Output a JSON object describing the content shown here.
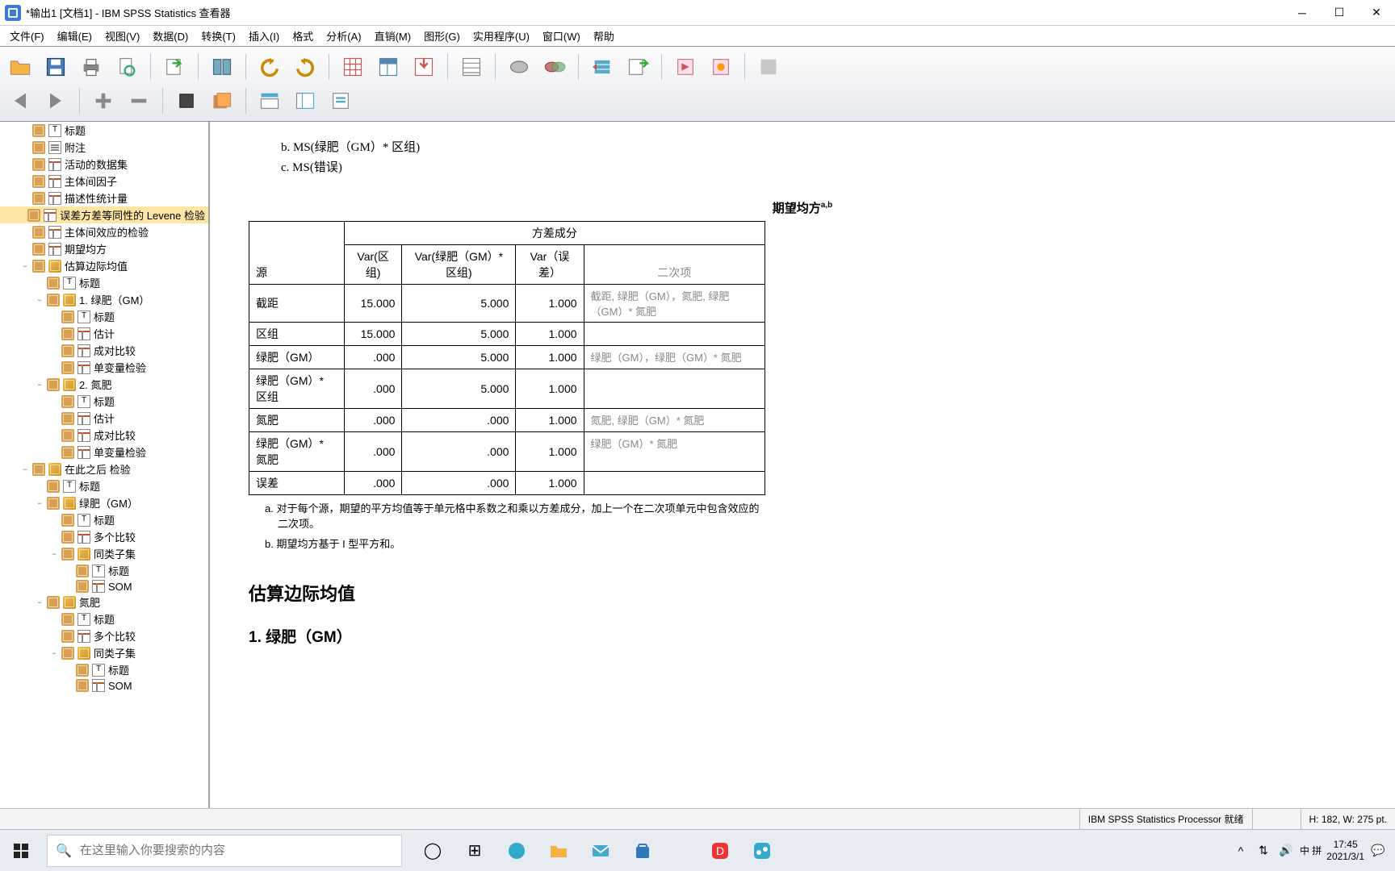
{
  "window": {
    "title": "*输出1 [文档1] - IBM SPSS Statistics 查看器"
  },
  "menu": {
    "file": "文件(F)",
    "edit": "编辑(E)",
    "view": "视图(V)",
    "data": "数据(D)",
    "transform": "转换(T)",
    "insert": "插入(I)",
    "format": "格式",
    "analyze": "分析(A)",
    "direct": "直销(M)",
    "graphs": "图形(G)",
    "utilities": "实用程序(U)",
    "window": "窗口(W)",
    "help": "帮助"
  },
  "outline": {
    "items": [
      {
        "label": "标题",
        "indent": 1,
        "icon": "title",
        "toggle": ""
      },
      {
        "label": "附注",
        "indent": 1,
        "icon": "note",
        "toggle": ""
      },
      {
        "label": "活动的数据集",
        "indent": 1,
        "icon": "table",
        "toggle": ""
      },
      {
        "label": "主体间因子",
        "indent": 1,
        "icon": "table",
        "toggle": ""
      },
      {
        "label": "描述性统计量",
        "indent": 1,
        "icon": "table",
        "toggle": ""
      },
      {
        "label": "误差方差等同性的 Levene 检验",
        "indent": 1,
        "icon": "table",
        "toggle": "",
        "selected": true
      },
      {
        "label": "主体间效应的检验",
        "indent": 1,
        "icon": "table",
        "toggle": ""
      },
      {
        "label": "期望均方",
        "indent": 1,
        "icon": "table",
        "toggle": ""
      },
      {
        "label": "估算边际均值",
        "indent": 1,
        "icon": "cube",
        "toggle": "−"
      },
      {
        "label": "标题",
        "indent": 2,
        "icon": "title",
        "toggle": ""
      },
      {
        "label": "1. 绿肥（GM）",
        "indent": 2,
        "icon": "cube",
        "toggle": "−"
      },
      {
        "label": "标题",
        "indent": 3,
        "icon": "title",
        "toggle": ""
      },
      {
        "label": "估计",
        "indent": 3,
        "icon": "table",
        "toggle": ""
      },
      {
        "label": "成对比较",
        "indent": 3,
        "icon": "table",
        "toggle": ""
      },
      {
        "label": "单变量检验",
        "indent": 3,
        "icon": "table",
        "toggle": ""
      },
      {
        "label": "2. 氮肥",
        "indent": 2,
        "icon": "cube",
        "toggle": "−"
      },
      {
        "label": "标题",
        "indent": 3,
        "icon": "title",
        "toggle": ""
      },
      {
        "label": "估计",
        "indent": 3,
        "icon": "table",
        "toggle": ""
      },
      {
        "label": "成对比较",
        "indent": 3,
        "icon": "table",
        "toggle": ""
      },
      {
        "label": "单变量检验",
        "indent": 3,
        "icon": "table",
        "toggle": ""
      },
      {
        "label": "在此之后 检验",
        "indent": 1,
        "icon": "cube",
        "toggle": "−"
      },
      {
        "label": "标题",
        "indent": 2,
        "icon": "title",
        "toggle": ""
      },
      {
        "label": "绿肥（GM）",
        "indent": 2,
        "icon": "cube",
        "toggle": "−"
      },
      {
        "label": "标题",
        "indent": 3,
        "icon": "title",
        "toggle": ""
      },
      {
        "label": "多个比较",
        "indent": 3,
        "icon": "table",
        "toggle": ""
      },
      {
        "label": "同类子集",
        "indent": 3,
        "icon": "cube",
        "toggle": "−"
      },
      {
        "label": "标题",
        "indent": 4,
        "icon": "title",
        "toggle": ""
      },
      {
        "label": "SOM",
        "indent": 4,
        "icon": "table",
        "toggle": ""
      },
      {
        "label": "氮肥",
        "indent": 2,
        "icon": "cube",
        "toggle": "−"
      },
      {
        "label": "标题",
        "indent": 3,
        "icon": "title",
        "toggle": ""
      },
      {
        "label": "多个比较",
        "indent": 3,
        "icon": "table",
        "toggle": ""
      },
      {
        "label": "同类子集",
        "indent": 3,
        "icon": "cube",
        "toggle": "−"
      },
      {
        "label": "标题",
        "indent": 4,
        "icon": "title",
        "toggle": ""
      },
      {
        "label": "SOM",
        "indent": 4,
        "icon": "table",
        "toggle": ""
      }
    ]
  },
  "content": {
    "line_b": "b. MS(绿肥（GM）* 区组)",
    "line_c": "c. MS(错误)",
    "table_title": "期望均方",
    "table_title_sup": "a,b",
    "col_source": "源",
    "col_group": "方差成分",
    "col_var1": "Var(区组)",
    "col_var2": "Var(绿肥（GM）* 区组)",
    "col_var3": "Var（误差）",
    "col_q": "二次项",
    "rows": [
      {
        "label": "截距",
        "v1": "15.000",
        "v2": "5.000",
        "v3": "1.000",
        "q": "截距, 绿肥（GM），氮肥, 绿肥（GM）* 氮肥"
      },
      {
        "label": "区组",
        "v1": "15.000",
        "v2": "5.000",
        "v3": "1.000",
        "q": ""
      },
      {
        "label": "绿肥（GM）",
        "v1": ".000",
        "v2": "5.000",
        "v3": "1.000",
        "q": "绿肥（GM），绿肥（GM）* 氮肥"
      },
      {
        "label": "绿肥（GM）* 区组",
        "v1": ".000",
        "v2": "5.000",
        "v3": "1.000",
        "q": ""
      },
      {
        "label": "氮肥",
        "v1": ".000",
        "v2": ".000",
        "v3": "1.000",
        "q": "氮肥, 绿肥（GM）* 氮肥"
      },
      {
        "label": "绿肥（GM）* 氮肥",
        "v1": ".000",
        "v2": ".000",
        "v3": "1.000",
        "q": "绿肥（GM）* 氮肥"
      },
      {
        "label": "误差",
        "v1": ".000",
        "v2": ".000",
        "v3": "1.000",
        "q": ""
      }
    ],
    "note_a": "a. 对于每个源，期望的平方均值等于单元格中系数之和乘以方差成分，加上一个在二次项单元中包含效应的二次项。",
    "note_b": "b. 期望均方基于 I 型平方和。",
    "sec1": "估算边际均值",
    "sec2": "1. 绿肥（GM）"
  },
  "status": {
    "processor": "IBM SPSS Statistics Processor 就绪",
    "dim": "H: 182, W: 275 pt."
  },
  "taskbar": {
    "search_placeholder": "在这里输入你要搜索的内容",
    "ime": "中 拼",
    "time": "17:45",
    "date": "2021/3/1"
  }
}
